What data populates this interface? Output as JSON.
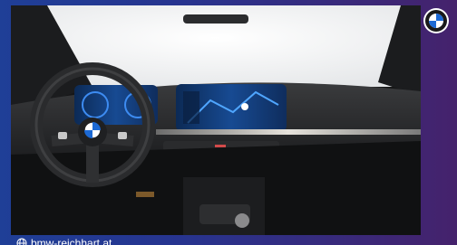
{
  "photo": {
    "subject": "car-interior-dashboard",
    "brand_logo": "bmw-roundel"
  },
  "footer": {
    "website": "bmw-reichhart.at",
    "icon": "globe-icon"
  },
  "colors": {
    "frame_left": "#1f3f97",
    "frame_right": "#45226c",
    "display_blue": "#1e6fd6"
  }
}
